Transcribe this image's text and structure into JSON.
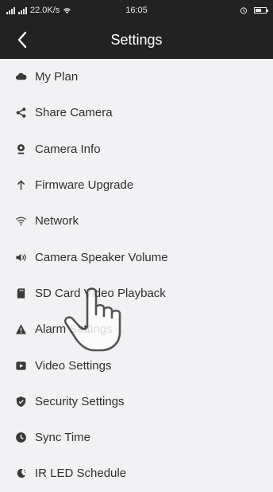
{
  "status_bar": {
    "network_speed": "22.0K/s",
    "time": "16:05"
  },
  "header": {
    "title": "Settings"
  },
  "menu": [
    {
      "label": "My Plan",
      "icon": "cloud-icon"
    },
    {
      "label": "Share Camera",
      "icon": "share-icon"
    },
    {
      "label": "Camera Info",
      "icon": "camera-icon"
    },
    {
      "label": "Firmware Upgrade",
      "icon": "arrow-up-icon"
    },
    {
      "label": "Network",
      "icon": "wifi-icon"
    },
    {
      "label": "Camera Speaker Volume",
      "icon": "speaker-icon"
    },
    {
      "label": "SD Card Video Playback",
      "icon": "sd-card-icon"
    },
    {
      "label": "Alarm Settings",
      "icon": "alert-icon"
    },
    {
      "label": "Video Settings",
      "icon": "video-icon"
    },
    {
      "label": "Security Settings",
      "icon": "shield-icon"
    },
    {
      "label": "Sync Time",
      "icon": "clock-icon"
    },
    {
      "label": "IR LED Schedule",
      "icon": "night-icon"
    }
  ],
  "colors": {
    "header_bg": "#222222",
    "page_bg": "#f2f2f4",
    "text": "#2f2f2f",
    "icon": "#3a3a3a"
  }
}
